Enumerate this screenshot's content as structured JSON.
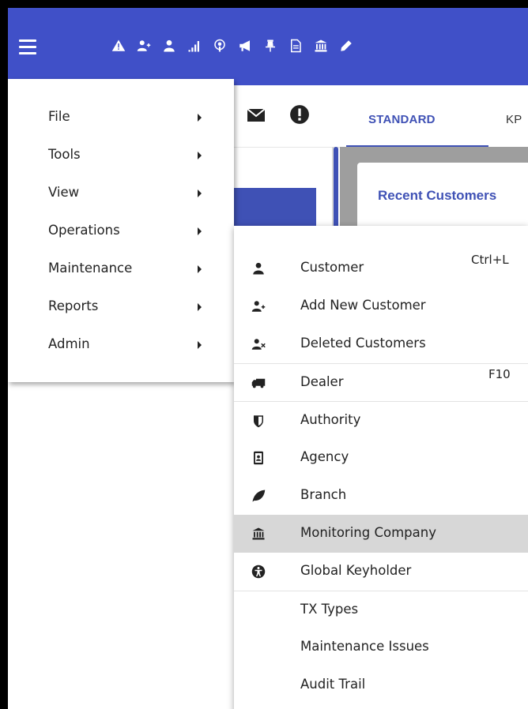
{
  "toolbar": {
    "icons": [
      "alert-triangle-icon",
      "add-user-icon",
      "user-icon",
      "signal-bars-icon",
      "podcast-icon",
      "bullhorn-icon",
      "thumbtack-icon",
      "document-icon",
      "bank-icon",
      "pencil-icon"
    ]
  },
  "tabs": [
    {
      "label": "STANDARD"
    },
    {
      "label": "KP"
    }
  ],
  "card": {
    "title": "Recent Customers"
  },
  "main_menu": {
    "items": [
      {
        "label": "File"
      },
      {
        "label": "Tools"
      },
      {
        "label": "View"
      },
      {
        "label": "Operations"
      },
      {
        "label": "Maintenance"
      },
      {
        "label": "Reports"
      },
      {
        "label": "Admin"
      }
    ]
  },
  "operations_menu": {
    "items": [
      {
        "label": "Customer",
        "shortcut": "Ctrl+L",
        "icon": "user-icon"
      },
      {
        "label": "Add New Customer",
        "icon": "add-user-icon"
      },
      {
        "label": "Deleted Customers",
        "icon": "delete-user-icon"
      },
      {
        "label": "Dealer",
        "shortcut": "F10",
        "icon": "truck-icon"
      },
      {
        "label": "Authority",
        "icon": "shield-icon"
      },
      {
        "label": "Agency",
        "icon": "id-badge-icon"
      },
      {
        "label": "Branch",
        "icon": "leaf-icon"
      },
      {
        "label": "Monitoring Company",
        "icon": "bank-icon"
      },
      {
        "label": "Global Keyholder",
        "icon": "universal-access-icon"
      },
      {
        "label": "TX Types"
      },
      {
        "label": "Maintenance Issues"
      },
      {
        "label": "Audit Trail"
      }
    ]
  },
  "colors": {
    "app_bar": "#4050c8",
    "accent": "#3f51b5",
    "highlight": "#d7d7d7",
    "content_bg": "#9e9e9e"
  }
}
